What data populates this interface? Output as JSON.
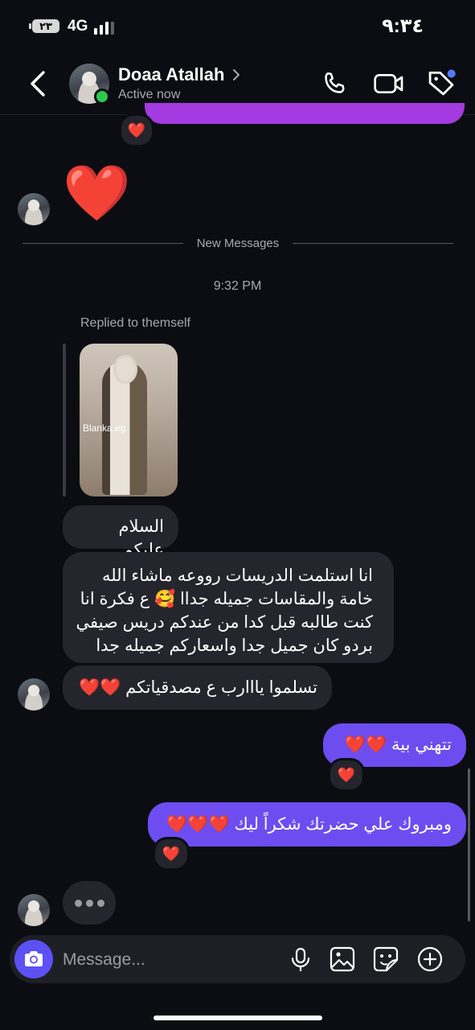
{
  "status_bar": {
    "battery": "٢٣",
    "network": "4G",
    "time": "٩:٣٤"
  },
  "header": {
    "contact_name": "Doaa Atallah",
    "status": "Active now",
    "icons": [
      "back-icon",
      "phone-icon",
      "video-icon",
      "tag-icon"
    ]
  },
  "conversation": {
    "reaction_heart": "❤️",
    "big_heart": "❤️",
    "divider_label": "New Messages",
    "timestamp": "9:32 PM",
    "reply_note": "Replied to themself",
    "photo_watermark": "Blanka.eg",
    "incoming": [
      "السلام عليكم",
      "انا استلمت الدريسات رووعه ماشاء الله خامة والمقاسات جميله جداا 🥰 ع فكرة انا كنت طالبه قبل كدا من عندكم دريس صيفي بردو كان جميل جدا واسعاركم جميله جدا",
      "تسلموا يااارب ع مصدقياتكم ❤️❤️"
    ],
    "outgoing": [
      "تتهني بية ❤️❤️",
      "ومبروك علي حضرتك شكراً ليك ❤️❤️❤️"
    ]
  },
  "composer": {
    "placeholder": "Message...",
    "icons": [
      "camera-icon",
      "microphone-icon",
      "gallery-icon",
      "sticker-icon",
      "plus-icon"
    ]
  },
  "colors": {
    "background": "#0c0d12",
    "incoming_bubble": "#25262d",
    "outgoing_bubble": "#6d4df0",
    "camera_button": "#5b51f5",
    "online": "#2cc84d",
    "notification_dot": "#4f7bff"
  }
}
